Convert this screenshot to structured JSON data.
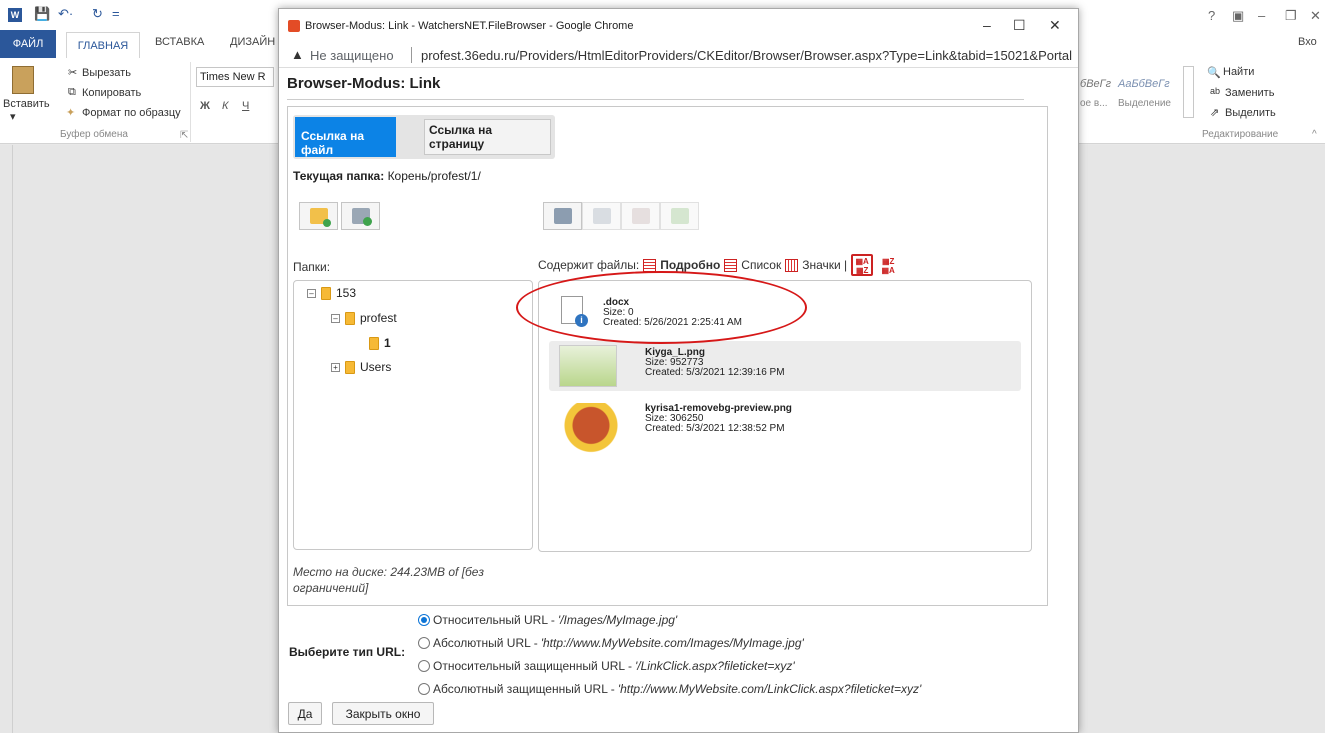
{
  "word": {
    "tab_file": "ФАЙЛ",
    "tab_home": "ГЛАВНАЯ",
    "tab_insert": "ВСТАВКА",
    "tab_design": "ДИЗАЙН",
    "cut": "Вырезать",
    "copy": "Копировать",
    "paste": "Вставить",
    "format_painter": "Формат по образцу",
    "clipboard_group": "Буфер обмена",
    "font_name": "Times New R",
    "style1": "бВеГг",
    "style2": "АаБбВеГг",
    "style_label1": "ое в...",
    "style_label2": "Выделение",
    "find": "Найти",
    "replace": "Заменить",
    "select": "Выделить",
    "editing_group": "Редактирование",
    "signin": "Вхо"
  },
  "chrome": {
    "window_title": "Browser-Modus: Link - WatchersNET.FileBrowser - Google Chrome",
    "not_secure": "Не защищено",
    "url": "profest.36edu.ru/Providers/HtmlEditorProviders/CKEditor/Browser/Browser.aspx?Type=Link&tabid=15021&Portal..."
  },
  "browser": {
    "heading": "Browser-Modus: Link",
    "tab_file": "Ссылка на файл",
    "tab_page": "Ссылка на страницу",
    "current_folder_label": "Текущая папка:",
    "current_folder_value": "Корень/profest/1/",
    "folders_label": "Папки:",
    "contains_files": "Содержит файлы:",
    "view_detailed": "Подробно",
    "view_list": "Список",
    "view_icons": "Значки |",
    "tree": [
      {
        "label": "153"
      },
      {
        "label": "profest"
      },
      {
        "label": "1"
      },
      {
        "label": "Users"
      }
    ],
    "files": [
      {
        "name": ".docx",
        "size": "Size: 0",
        "created": "Created: 5/26/2021 2:25:41 AM"
      },
      {
        "name": "Kiyga_L.png",
        "size": "Size: 952773",
        "created": "Created: 5/3/2021 12:39:16 PM"
      },
      {
        "name": "kyrisa1-removebg-preview.png",
        "size": "Size: 306250",
        "created": "Created: 5/3/2021 12:38:52 PM"
      }
    ],
    "disk_space": "Место на диске: 244.23MB of [без ограничений]",
    "url_type_label": "Выберите тип URL:",
    "url_options": [
      {
        "label": "Относительный URL - ",
        "example": "'/Images/MyImage.jpg'",
        "checked": true
      },
      {
        "label": "Абсолютный URL - ",
        "example": "'http://www.MyWebsite.com/Images/MyImage.jpg'",
        "checked": false
      },
      {
        "label": "Относительный защищенный URL - ",
        "example": "'/LinkClick.aspx?fileticket=xyz'",
        "checked": false
      },
      {
        "label": "Абсолютный защищенный URL - ",
        "example": "'http://www.MyWebsite.com/LinkClick.aspx?fileticket=xyz'",
        "checked": false
      }
    ],
    "btn_ok": "Да",
    "btn_close": "Закрыть окно"
  },
  "colors": {
    "accent": "#0c83e6",
    "word_blue": "#2b579a",
    "annotation_red": "#d61818"
  }
}
